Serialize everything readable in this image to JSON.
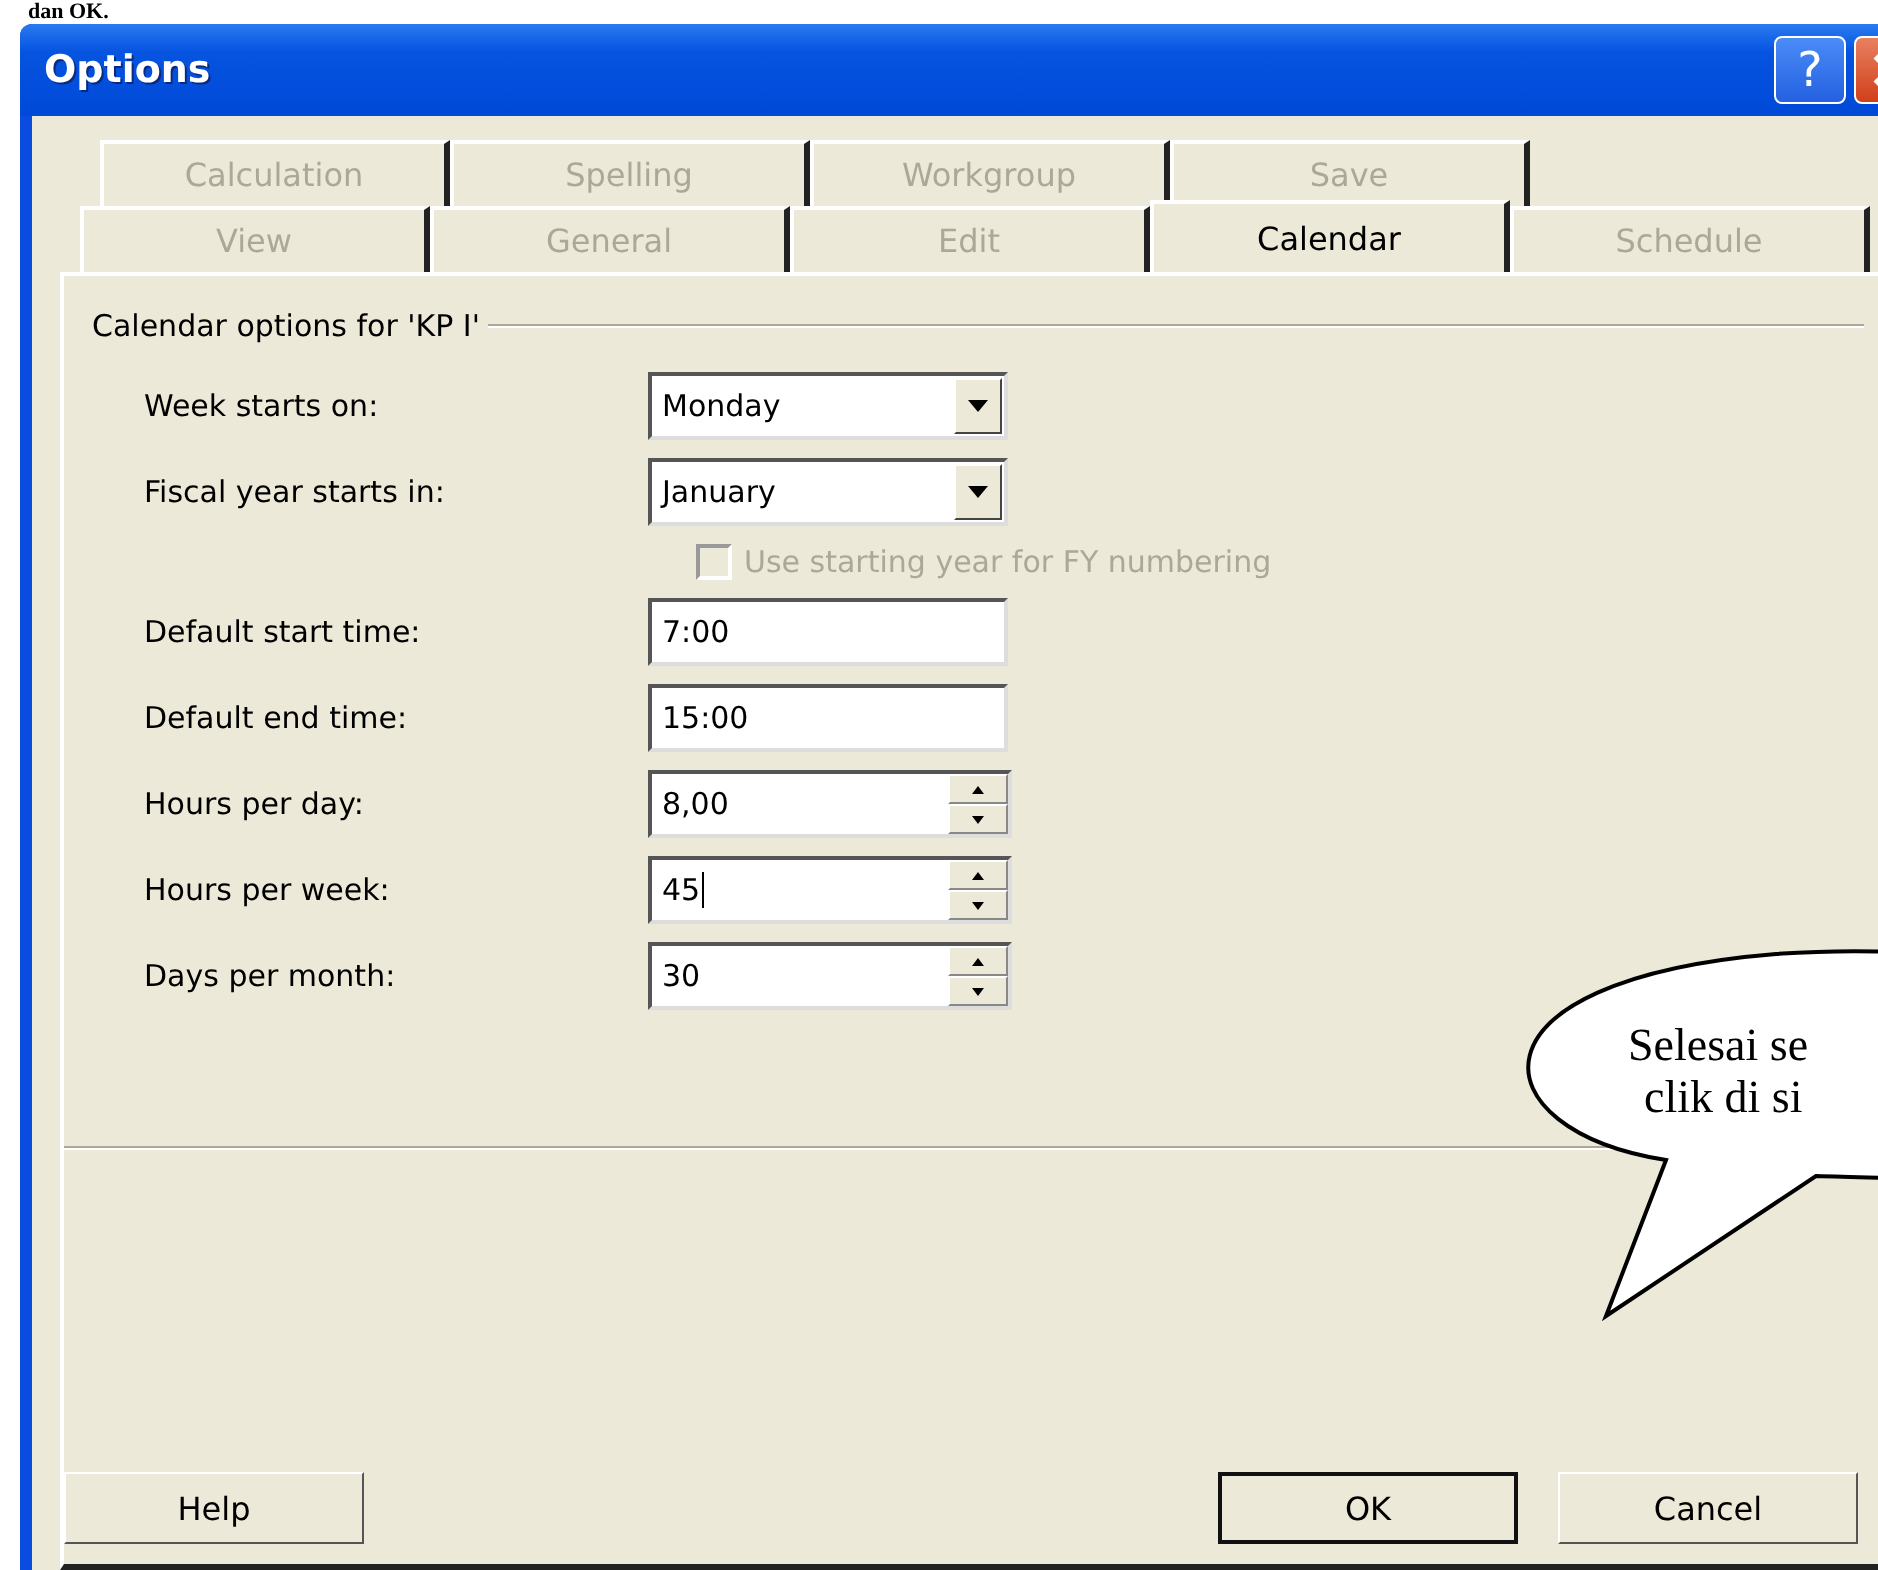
{
  "header_text": "dan OK.",
  "window": {
    "title": "Options",
    "help_glyph": "?"
  },
  "tab_rows": [
    {
      "tabs": [
        {
          "label": "Calculation",
          "selected": false
        },
        {
          "label": "Spelling",
          "selected": false
        },
        {
          "label": "Workgroup",
          "selected": false
        },
        {
          "label": "Save",
          "selected": false
        }
      ]
    },
    {
      "tabs": [
        {
          "label": "View",
          "selected": false
        },
        {
          "label": "General",
          "selected": false
        },
        {
          "label": "Edit",
          "selected": false
        },
        {
          "label": "Calendar",
          "selected": true
        },
        {
          "label": "Schedule",
          "selected": false
        }
      ]
    }
  ],
  "group_label": "Calendar options for 'KP I'",
  "fields": [
    {
      "kind": "dropdown",
      "label": "Week starts on:",
      "value": "Monday"
    },
    {
      "kind": "dropdown",
      "label": "Fiscal year starts in:",
      "value": "January"
    },
    {
      "kind": "checkbox",
      "label": "Use starting year for FY numbering",
      "checked": false,
      "disabled": true
    },
    {
      "kind": "text",
      "label": "Default start time:",
      "value": "7:00"
    },
    {
      "kind": "text",
      "label": "Default end time:",
      "value": "15:00"
    },
    {
      "kind": "spinner",
      "label": "Hours per day:",
      "value": "8,00",
      "focused": false
    },
    {
      "kind": "spinner",
      "label": "Hours per week:",
      "value": "45",
      "focused": true
    },
    {
      "kind": "spinner",
      "label": "Days per month:",
      "value": "30",
      "focused": false
    }
  ],
  "buttons": [
    {
      "label": "Help",
      "default": false
    },
    {
      "label": "OK",
      "default": true
    },
    {
      "label": "Cancel",
      "default": false
    }
  ],
  "callout": {
    "lines": [
      "Selesai se",
      "clik di si"
    ]
  }
}
